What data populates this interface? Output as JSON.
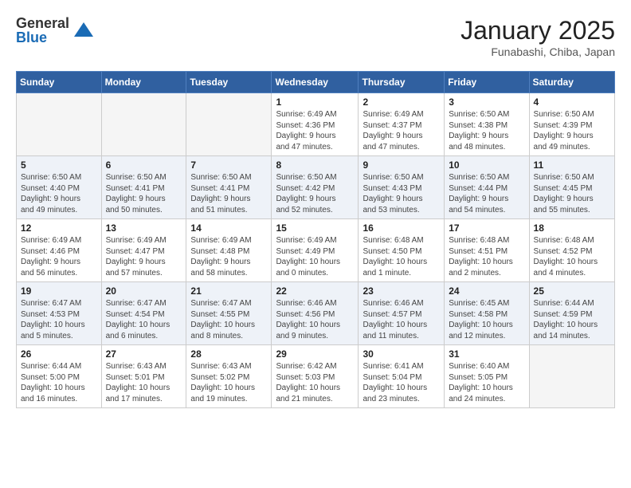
{
  "header": {
    "logo_general": "General",
    "logo_blue": "Blue",
    "title": "January 2025",
    "subtitle": "Funabashi, Chiba, Japan"
  },
  "days_of_week": [
    "Sunday",
    "Monday",
    "Tuesday",
    "Wednesday",
    "Thursday",
    "Friday",
    "Saturday"
  ],
  "weeks": [
    [
      {
        "day": "",
        "info": ""
      },
      {
        "day": "",
        "info": ""
      },
      {
        "day": "",
        "info": ""
      },
      {
        "day": "1",
        "info": "Sunrise: 6:49 AM\nSunset: 4:36 PM\nDaylight: 9 hours\nand 47 minutes."
      },
      {
        "day": "2",
        "info": "Sunrise: 6:49 AM\nSunset: 4:37 PM\nDaylight: 9 hours\nand 47 minutes."
      },
      {
        "day": "3",
        "info": "Sunrise: 6:50 AM\nSunset: 4:38 PM\nDaylight: 9 hours\nand 48 minutes."
      },
      {
        "day": "4",
        "info": "Sunrise: 6:50 AM\nSunset: 4:39 PM\nDaylight: 9 hours\nand 49 minutes."
      }
    ],
    [
      {
        "day": "5",
        "info": "Sunrise: 6:50 AM\nSunset: 4:40 PM\nDaylight: 9 hours\nand 49 minutes."
      },
      {
        "day": "6",
        "info": "Sunrise: 6:50 AM\nSunset: 4:41 PM\nDaylight: 9 hours\nand 50 minutes."
      },
      {
        "day": "7",
        "info": "Sunrise: 6:50 AM\nSunset: 4:41 PM\nDaylight: 9 hours\nand 51 minutes."
      },
      {
        "day": "8",
        "info": "Sunrise: 6:50 AM\nSunset: 4:42 PM\nDaylight: 9 hours\nand 52 minutes."
      },
      {
        "day": "9",
        "info": "Sunrise: 6:50 AM\nSunset: 4:43 PM\nDaylight: 9 hours\nand 53 minutes."
      },
      {
        "day": "10",
        "info": "Sunrise: 6:50 AM\nSunset: 4:44 PM\nDaylight: 9 hours\nand 54 minutes."
      },
      {
        "day": "11",
        "info": "Sunrise: 6:50 AM\nSunset: 4:45 PM\nDaylight: 9 hours\nand 55 minutes."
      }
    ],
    [
      {
        "day": "12",
        "info": "Sunrise: 6:49 AM\nSunset: 4:46 PM\nDaylight: 9 hours\nand 56 minutes."
      },
      {
        "day": "13",
        "info": "Sunrise: 6:49 AM\nSunset: 4:47 PM\nDaylight: 9 hours\nand 57 minutes."
      },
      {
        "day": "14",
        "info": "Sunrise: 6:49 AM\nSunset: 4:48 PM\nDaylight: 9 hours\nand 58 minutes."
      },
      {
        "day": "15",
        "info": "Sunrise: 6:49 AM\nSunset: 4:49 PM\nDaylight: 10 hours\nand 0 minutes."
      },
      {
        "day": "16",
        "info": "Sunrise: 6:48 AM\nSunset: 4:50 PM\nDaylight: 10 hours\nand 1 minute."
      },
      {
        "day": "17",
        "info": "Sunrise: 6:48 AM\nSunset: 4:51 PM\nDaylight: 10 hours\nand 2 minutes."
      },
      {
        "day": "18",
        "info": "Sunrise: 6:48 AM\nSunset: 4:52 PM\nDaylight: 10 hours\nand 4 minutes."
      }
    ],
    [
      {
        "day": "19",
        "info": "Sunrise: 6:47 AM\nSunset: 4:53 PM\nDaylight: 10 hours\nand 5 minutes."
      },
      {
        "day": "20",
        "info": "Sunrise: 6:47 AM\nSunset: 4:54 PM\nDaylight: 10 hours\nand 6 minutes."
      },
      {
        "day": "21",
        "info": "Sunrise: 6:47 AM\nSunset: 4:55 PM\nDaylight: 10 hours\nand 8 minutes."
      },
      {
        "day": "22",
        "info": "Sunrise: 6:46 AM\nSunset: 4:56 PM\nDaylight: 10 hours\nand 9 minutes."
      },
      {
        "day": "23",
        "info": "Sunrise: 6:46 AM\nSunset: 4:57 PM\nDaylight: 10 hours\nand 11 minutes."
      },
      {
        "day": "24",
        "info": "Sunrise: 6:45 AM\nSunset: 4:58 PM\nDaylight: 10 hours\nand 12 minutes."
      },
      {
        "day": "25",
        "info": "Sunrise: 6:44 AM\nSunset: 4:59 PM\nDaylight: 10 hours\nand 14 minutes."
      }
    ],
    [
      {
        "day": "26",
        "info": "Sunrise: 6:44 AM\nSunset: 5:00 PM\nDaylight: 10 hours\nand 16 minutes."
      },
      {
        "day": "27",
        "info": "Sunrise: 6:43 AM\nSunset: 5:01 PM\nDaylight: 10 hours\nand 17 minutes."
      },
      {
        "day": "28",
        "info": "Sunrise: 6:43 AM\nSunset: 5:02 PM\nDaylight: 10 hours\nand 19 minutes."
      },
      {
        "day": "29",
        "info": "Sunrise: 6:42 AM\nSunset: 5:03 PM\nDaylight: 10 hours\nand 21 minutes."
      },
      {
        "day": "30",
        "info": "Sunrise: 6:41 AM\nSunset: 5:04 PM\nDaylight: 10 hours\nand 23 minutes."
      },
      {
        "day": "31",
        "info": "Sunrise: 6:40 AM\nSunset: 5:05 PM\nDaylight: 10 hours\nand 24 minutes."
      },
      {
        "day": "",
        "info": ""
      }
    ]
  ]
}
